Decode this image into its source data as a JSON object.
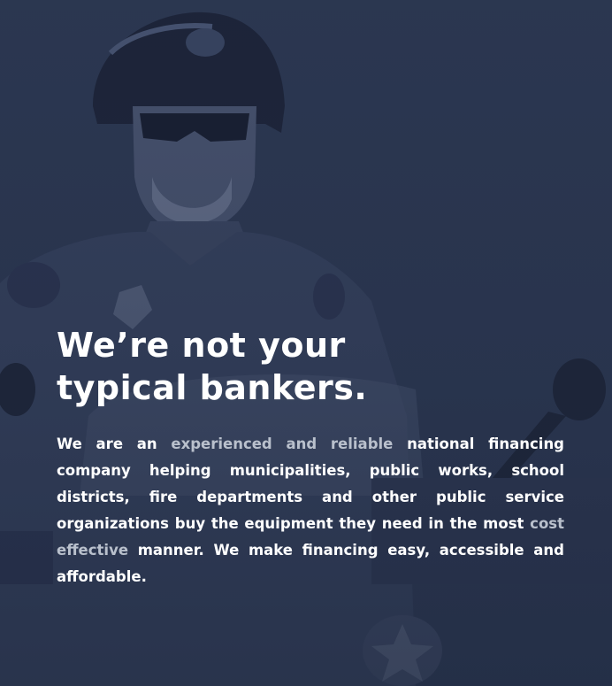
{
  "hero": {
    "headline_line1": "We’re not your",
    "headline_line2": "typical bankers.",
    "body": {
      "part1": "We are an ",
      "highlight1": "experienced and reliable",
      "part2": " national financing company helping municipalities, public works, school districts, fire departments and other public service organizations buy the equipment they need in the most ",
      "highlight2": "cost effective",
      "part3": " manner.  We make financing easy, accessible and affordable."
    }
  },
  "colors": {
    "background": "#2a3650",
    "text": "#ffffff",
    "highlight": "#b9c0cc"
  }
}
